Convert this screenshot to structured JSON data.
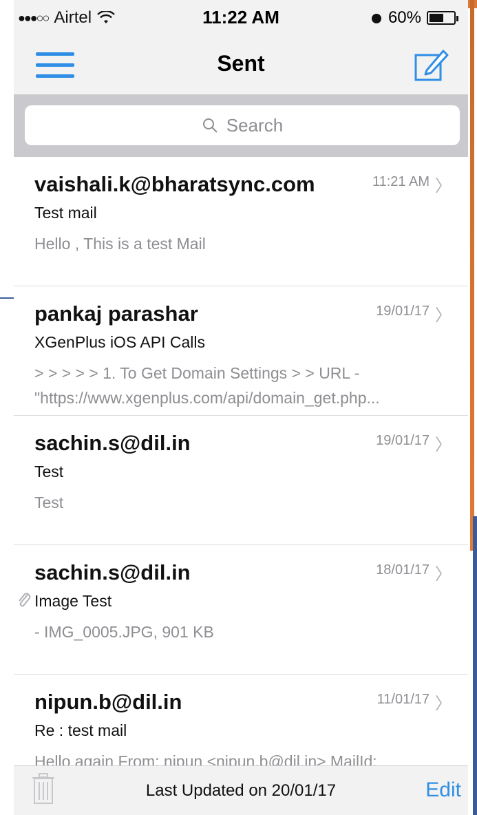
{
  "status_bar": {
    "signal_dots": "●●●○○",
    "carrier": "Airtel",
    "time": "11:22 AM",
    "battery": "60%",
    "battery_level": 0.6
  },
  "nav": {
    "title": "Sent"
  },
  "search": {
    "placeholder": "Search"
  },
  "mails": [
    {
      "sender": "vaishali.k@bharatsync.com",
      "date": "11:21 AM",
      "subject": "Test mail",
      "preview_1": "Hello , This is a test Mail",
      "preview_2": ""
    },
    {
      "sender": "pankaj parashar",
      "date": "19/01/17",
      "subject": "XGenPlus iOS API Calls",
      "preview_1": "> > > > > 1. To Get Domain Settings > > URL -",
      "preview_2": "\"https://www.xgenplus.com/api/domain_get.php..."
    },
    {
      "sender": "sachin.s@dil.in",
      "date": "19/01/17",
      "subject": "Test",
      "preview_1": "Test",
      "preview_2": ""
    },
    {
      "sender": "sachin.s@dil.in",
      "date": "18/01/17",
      "subject": "Image Test",
      "preview_1": "- IMG_0005.JPG, 901 KB",
      "preview_2": "",
      "has_attachment": true
    },
    {
      "sender": "nipun.b@dil.in",
      "date": "11/01/17",
      "subject": "Re : test mail",
      "preview_1": "Hello again From: nipun <nipun.b@dil.in> MailId:",
      "preview_2": ""
    }
  ],
  "bottom_bar": {
    "last_updated": "Last Updated on 20/01/17",
    "edit_label": "Edit"
  },
  "colors": {
    "accent": "#2f8fe6",
    "secondary_text": "#8e8e93"
  }
}
